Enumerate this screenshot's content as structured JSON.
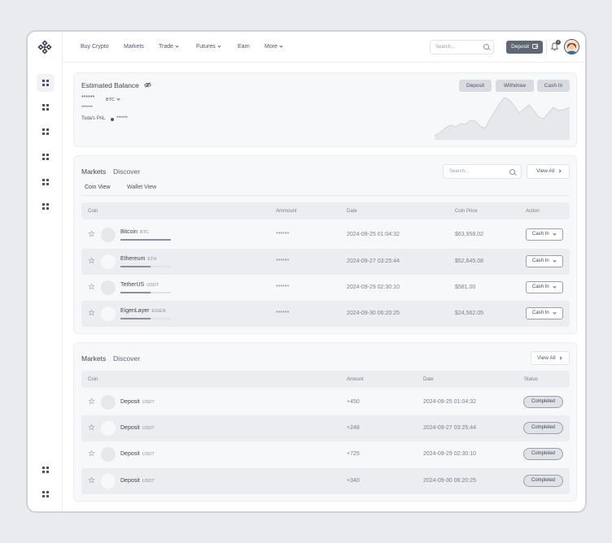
{
  "nav": {
    "items": [
      {
        "label": "Buy Crypto",
        "dropdown": false
      },
      {
        "label": "Markets",
        "dropdown": false
      },
      {
        "label": "Trade",
        "dropdown": true
      },
      {
        "label": "Futures",
        "dropdown": true
      },
      {
        "label": "Earn",
        "dropdown": false
      },
      {
        "label": "More",
        "dropdown": true
      }
    ],
    "search_placeholder": "Search...",
    "deposit_label": "Deposit",
    "notification_count": "2"
  },
  "balance": {
    "title": "Estimated Balance",
    "amount_masked": "******",
    "currency": "BTC",
    "fiat_masked": "******",
    "pnl_label": "Toda's PnL",
    "pnl_masked": "******",
    "buttons": {
      "deposit": "Deposit",
      "withdraw": "Withdraw",
      "cash_in": "Cash In"
    }
  },
  "markets": {
    "tab_markets": "Markets",
    "tab_discover": "Discover",
    "search_placeholder": "Search...",
    "view_all": "View All",
    "subtab_coin": "Coin View",
    "subtab_wallet": "Wallet View",
    "columns": {
      "coin": "Coin",
      "amount": "Ammount",
      "date": "Date",
      "price": "Coin Price",
      "action": "Action"
    },
    "rows": [
      {
        "name": "Bitcoin",
        "symbol": "BTC",
        "amount": "******",
        "date": "2024-09-25 01:04:32",
        "price": "$63,958.02",
        "action": "Cash In",
        "progress": 1.0
      },
      {
        "name": "Ethereum",
        "symbol": "ETH",
        "amount": "******",
        "date": "2024-09-27 03:25:44",
        "price": "$52,645.08",
        "action": "Cash In",
        "progress": 0.6
      },
      {
        "name": "TetherUS",
        "symbol": "USDT",
        "amount": "******",
        "date": "2024-09-29 02:30:10",
        "price": "$581.00",
        "action": "Cash In",
        "progress": 0.6
      },
      {
        "name": "EigenLayer",
        "symbol": "EIGEN",
        "amount": "******",
        "date": "2024-09-30 06:20:25",
        "price": "$24,562.05",
        "action": "Cash In",
        "progress": 0.6
      }
    ]
  },
  "transactions": {
    "tab_markets": "Markets",
    "tab_discover": "Discover",
    "view_all": "View All",
    "columns": {
      "coin": "Coin",
      "amount": "Amount",
      "date": "Date",
      "status": "Status"
    },
    "rows": [
      {
        "type": "Deposit",
        "symbol": "USDT",
        "amount": "+450",
        "date": "2024-09-25 01:04:32",
        "status": "Completed"
      },
      {
        "type": "Deposit",
        "symbol": "USDT",
        "amount": "+248",
        "date": "2024-09-27 03:25:44",
        "status": "Completed"
      },
      {
        "type": "Deposit",
        "symbol": "USDT",
        "amount": "+725",
        "date": "2024-09-29 02:30:10",
        "status": "Completed"
      },
      {
        "type": "Deposit",
        "symbol": "USDT",
        "amount": "+340",
        "date": "2024-09-30 06:20:25",
        "status": "Completed"
      }
    ]
  },
  "colors": {
    "accent": "#5f6775",
    "background": "#e9ebee",
    "card": "#f7f8f9",
    "text": "#3f4654"
  }
}
